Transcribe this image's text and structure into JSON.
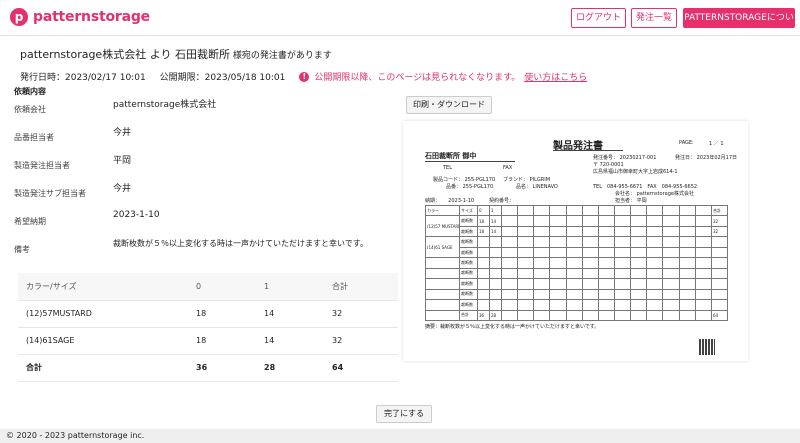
{
  "header": {
    "logo_text": "patternstorage",
    "logo_mark": "p",
    "logout_label": "ログアウト",
    "order_list_label": "発注一覧",
    "about_label": "PATTERNSTORAGEについて"
  },
  "title": {
    "sender": "patternstorage株式会社",
    "connector": " より ",
    "receiver": "石田裁断所",
    "suffix": " 様宛の発注書があります"
  },
  "meta": {
    "issue_date": "発行日時：2023/02/17 10:01",
    "public_limit": "公開期限：2023/05/18 10:01",
    "warning": "公開期限以降、このページは見られなくなります。",
    "help_link": "使い方はこちら",
    "warning_icon": "exclamation-circle-icon"
  },
  "request": {
    "heading": "依頼内容",
    "rows": [
      {
        "label": "依頼会社",
        "value": "patternstorage株式会社"
      },
      {
        "label": "品番担当者",
        "value": "今井"
      },
      {
        "label": "製造発注担当者",
        "value": "平岡"
      },
      {
        "label": "製造発注サブ担当者",
        "value": "今井"
      },
      {
        "label": "希望納期",
        "value": "2023-1-10"
      },
      {
        "label": "備考",
        "value": "裁断枚数が５％以上変化する時は一声かけていただけますと幸いです。"
      }
    ]
  },
  "print_button": "印刷・ダウンロード",
  "quantity_table": {
    "headers": [
      "カラー/サイズ",
      "0",
      "1",
      "合計"
    ],
    "rows": [
      [
        "(12)57MUSTARD",
        "18",
        "14",
        "32"
      ],
      [
        "(14)61SAGE",
        "18",
        "14",
        "32"
      ]
    ],
    "total": [
      "合計",
      "36",
      "28",
      "64"
    ]
  },
  "document": {
    "title": "製品発注書",
    "page_label": "PAGE:",
    "page_value": "1 ／ 1",
    "recipient": "石田裁断所 御中",
    "tel": "TEL",
    "fax": "FAX",
    "order_no": "発注番号： 20230217-001",
    "issue_date": "発注日： 2023年02月17日",
    "postal": "〒 720-0001",
    "address": "広島県福山市御幸町大字上岩成614-1",
    "product_code": "製品コード： 255-PGL170",
    "brand": "ブランド： PILGRIM",
    "item_no": "品番： 255-PGL170",
    "material": "品名： LINENAVO",
    "company_tel": "TEL　084-955-6671　FAX　084-955-6652",
    "company": "会社名： patternstorage株式会社",
    "person": "担当者： 平岡",
    "delivery": "納期： 　 2023-1-10",
    "contract": "契約番号：",
    "grid_color_label": "カラー",
    "grid_size_label": "サイズ",
    "grid_cut_label": "裁断数",
    "grid_total_label": "合計",
    "grid_row1_color": "(12)57 MUSTARD",
    "grid_row2_color": "(14)61 SAGE",
    "grid_row_total": "64",
    "note": "摘要：裁断枚数が５％以上変化する時は一声かけていただけますと幸いです。"
  },
  "complete_button": "完了にする",
  "footer": "© 2020 - 2023 patternstorage inc."
}
